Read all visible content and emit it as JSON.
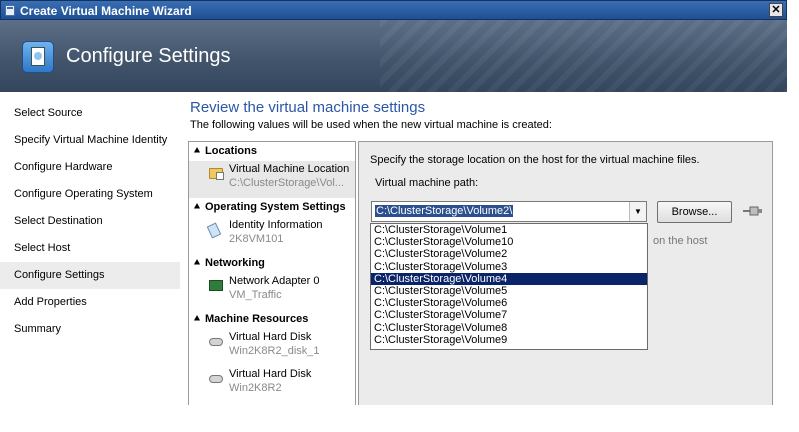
{
  "window": {
    "title": "Create Virtual Machine Wizard",
    "close_label": "✕"
  },
  "banner": {
    "title": "Configure Settings"
  },
  "nav": {
    "items": [
      {
        "label": "Select Source"
      },
      {
        "label": "Specify Virtual Machine Identity"
      },
      {
        "label": "Configure Hardware"
      },
      {
        "label": "Configure Operating System"
      },
      {
        "label": "Select Destination"
      },
      {
        "label": "Select Host"
      },
      {
        "label": "Configure Settings",
        "active": true
      },
      {
        "label": "Add Properties"
      },
      {
        "label": "Summary"
      }
    ]
  },
  "main": {
    "heading": "Review the virtual machine settings",
    "subheading": "The following values will be used when the new virtual machine is created:"
  },
  "summary": {
    "sections": [
      {
        "title": "Locations",
        "items": [
          {
            "icon": "folder-icon",
            "line1": "Virtual Machine Location",
            "line2": "C:\\ClusterStorage\\Vol..."
          }
        ]
      },
      {
        "title": "Operating System Settings",
        "items": [
          {
            "icon": "identity-icon",
            "line1": "Identity Information",
            "line2": "2K8VM101"
          }
        ]
      },
      {
        "title": "Networking",
        "items": [
          {
            "icon": "network-adapter-icon",
            "line1": "Network Adapter 0",
            "line2": "VM_Traffic"
          }
        ]
      },
      {
        "title": "Machine Resources",
        "items": [
          {
            "icon": "hard-disk-icon",
            "line1": "Virtual Hard Disk",
            "line2": "Win2K8R2_disk_1"
          },
          {
            "icon": "hard-disk-icon",
            "line1": "Virtual Hard Disk",
            "line2": "Win2K8R2"
          }
        ]
      }
    ]
  },
  "details": {
    "instruction": "Specify the storage location on the host for the virtual machine files.",
    "path_label": "Virtual machine path:",
    "path_value": "C:\\ClusterStorage\\Volume2\\",
    "browse_label": "Browse...",
    "hint": "on the host",
    "dropdown_options": [
      "C:\\ClusterStorage\\Volume1",
      "C:\\ClusterStorage\\Volume10",
      "C:\\ClusterStorage\\Volume2",
      "C:\\ClusterStorage\\Volume3",
      "C:\\ClusterStorage\\Volume4",
      "C:\\ClusterStorage\\Volume5",
      "C:\\ClusterStorage\\Volume6",
      "C:\\ClusterStorage\\Volume7",
      "C:\\ClusterStorage\\Volume8",
      "C:\\ClusterStorage\\Volume9"
    ],
    "highlighted_option": "C:\\ClusterStorage\\Volume4"
  },
  "colors": {
    "accent": "#2b57a6",
    "selection": "#0a246a",
    "titlebar": "#1f4f95"
  }
}
